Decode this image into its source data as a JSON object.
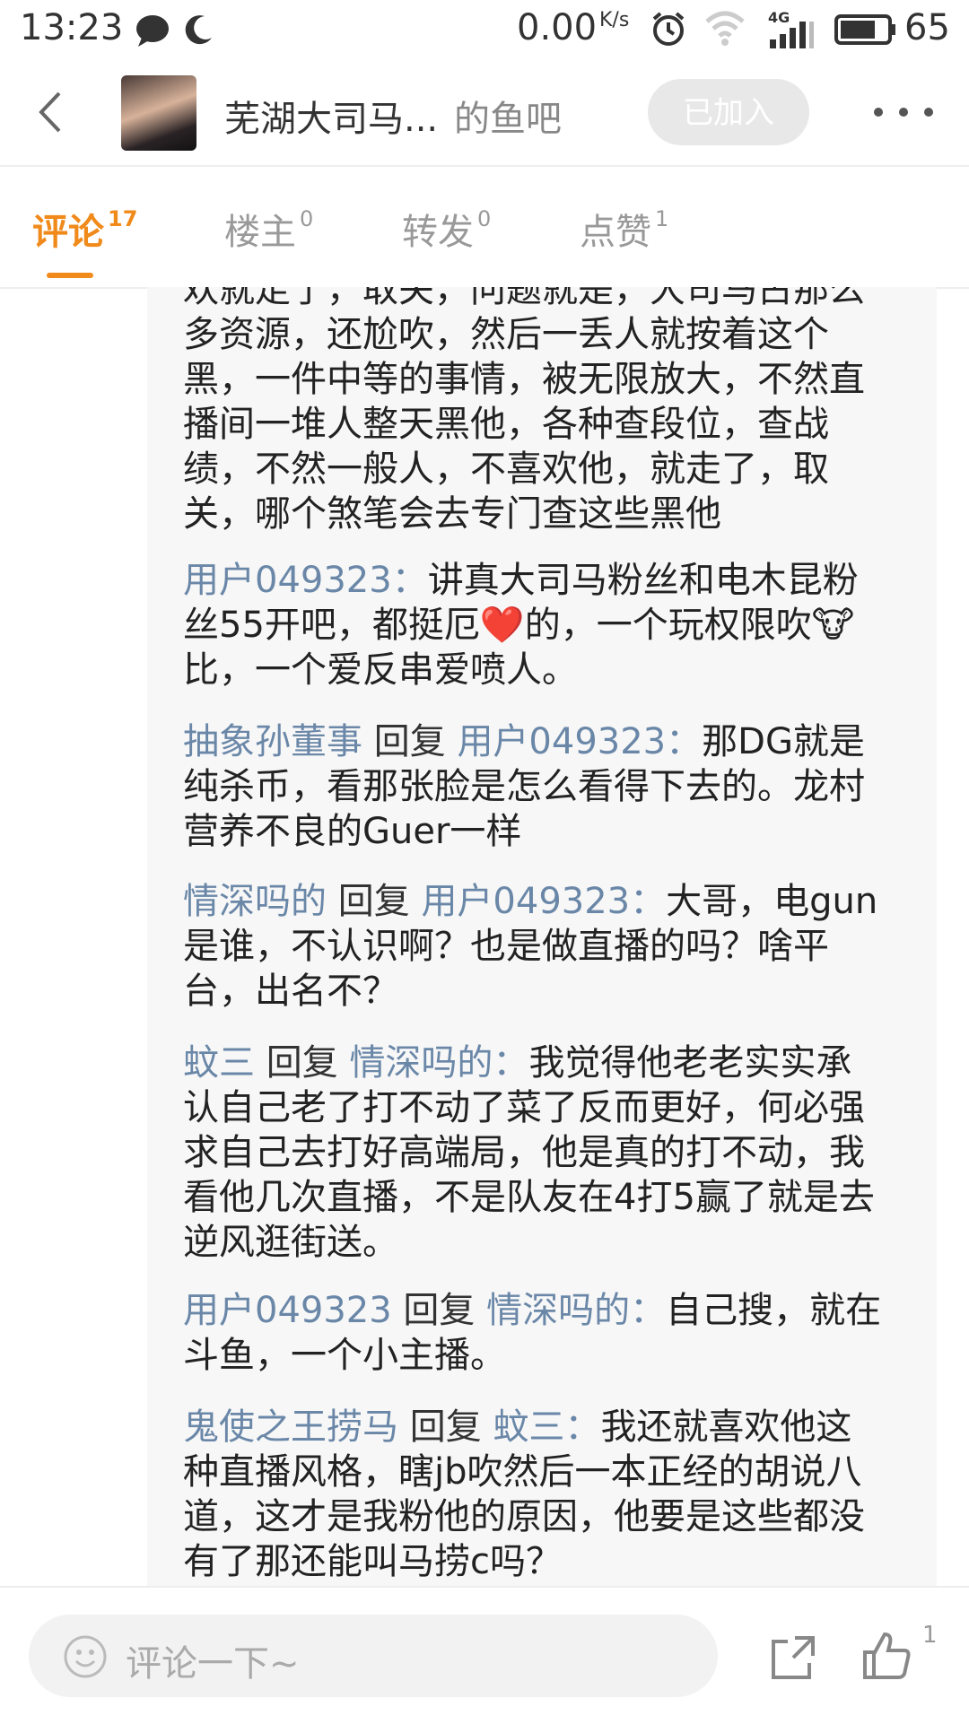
{
  "status_bar": {
    "time": "13:23",
    "net_speed": "0.00",
    "net_unit": "K/s",
    "network": "4G",
    "battery": "65"
  },
  "header": {
    "title": "芜湖大司马...",
    "title_suffix": "的鱼吧",
    "joined_label": "已加入"
  },
  "tabs": [
    {
      "label": "评论",
      "count": "17"
    },
    {
      "label": "楼主",
      "count": "0"
    },
    {
      "label": "转发",
      "count": "0"
    },
    {
      "label": "点赞",
      "count": "1"
    }
  ],
  "comment": {
    "partial_top": "欢就走了，取关，问题就是，大司马占那么",
    "line1": "多资源，还尬吹，然后一丢人就按着这个",
    "line2": "黑，一件中等的事情，被无限放大，不然直",
    "line3": "播间一堆人整天黑他，各种查段位，查战",
    "line4": "绩，不然一般人，不喜欢他，就走了，取",
    "line5": "关，哪个煞笔会去专门查这些黑他"
  },
  "replies": [
    {
      "user": "用户049323：",
      "verb": "",
      "target": "",
      "text_lines": [
        "讲真大司马粉丝和电木昆粉",
        "丝55开吧，都挺厄❤️的，一个玩权限吹🐮",
        "比，一个爱反串爱喷人。"
      ]
    },
    {
      "user": "抽象孙董事",
      "verb": " 回复 ",
      "target": "用户049323：",
      "text_lines": [
        "那DG就是",
        "纯杀币，看那张脸是怎么看得下去的。龙村",
        "营养不良的Guer一样"
      ]
    },
    {
      "user": "情深吗的",
      "verb": " 回复 ",
      "target": "用户049323：",
      "text_lines": [
        "大哥，电gun",
        "是谁，不认识啊？也是做直播的吗？啥平",
        "台，出名不？"
      ]
    },
    {
      "user": "蚊三",
      "verb": " 回复 ",
      "target": "情深吗的：",
      "text_lines": [
        "我觉得他老老实实承",
        "认自己老了打不动了菜了反而更好，何必强",
        "求自己去打好高端局，他是真的打不动，我",
        "看他几次直播，不是队友在4打5赢了就是去",
        "逆风逛街送。"
      ]
    },
    {
      "user": "用户049323",
      "verb": " 回复 ",
      "target": "情深吗的：",
      "text_lines": [
        "自己搜，就在",
        "斗鱼，一个小主播。"
      ]
    },
    {
      "user": "鬼使之王捞马",
      "verb": " 回复 ",
      "target": "蚊三：",
      "text_lines": [
        "我还就喜欢他这",
        "种直播风格，瞎jb吹然后一本正经的胡说八",
        "道，这才是我粉他的原因，他要是这些都没",
        "有了那还能叫马捞c吗？"
      ]
    }
  ],
  "bottom_bar": {
    "placeholder": "评论一下~",
    "like_count": "1"
  },
  "colors": {
    "accent": "#f08a1a",
    "username": "#6a87a8"
  }
}
